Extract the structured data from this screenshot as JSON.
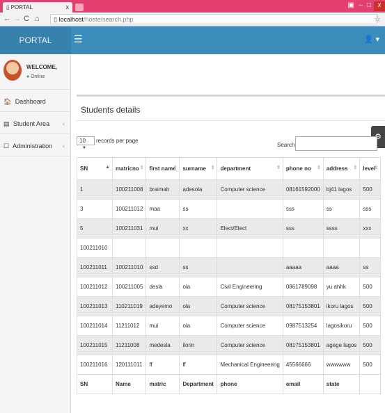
{
  "browser": {
    "tab_title": "PORTAL",
    "tab_close": "x",
    "url_host": "localhost",
    "url_path": "/hoste/search.php",
    "win_min": "‒",
    "win_max": "□",
    "win_close": "x"
  },
  "app": {
    "brand": "PORTAL",
    "hamburger": "☰",
    "user_icon": "👤 ▾"
  },
  "sidebar": {
    "welcome": "WELCOME,",
    "status": "Online",
    "items": [
      {
        "label": "Dashboard",
        "icon": "🏠",
        "icon_name": "dashboard-icon"
      },
      {
        "label": "Student Area",
        "icon": "▤",
        "icon_name": "student-area-icon"
      },
      {
        "label": "Administration",
        "icon": "☐",
        "icon_name": "administration-icon"
      }
    ]
  },
  "panel": {
    "title": "Students details",
    "length_value": "10",
    "length_suffix": "records per page",
    "search_label": "Search:",
    "settings_icon": "⚙"
  },
  "table": {
    "headers": [
      "SN",
      "matricno",
      "first name",
      "surname",
      "department",
      "phone no",
      "address",
      "level"
    ],
    "rows": [
      [
        "1",
        "100211008",
        "braimah",
        "adesola",
        "Computer science",
        "08161592000",
        "bj41 lagos",
        "500"
      ],
      [
        "3",
        "100211012",
        "maa",
        "ss",
        "",
        "sss",
        "ss",
        "sss"
      ],
      [
        "5",
        "100211031",
        "mui",
        "xx",
        "Elect/Elect",
        "sss",
        "ssss",
        "xxx"
      ],
      [
        "100211010",
        "",
        "",
        "",
        "",
        "",
        "",
        ""
      ],
      [
        "100211011",
        "100211010",
        "ssd",
        "ss",
        "",
        "aaaaa",
        "aaaa",
        "ss"
      ],
      [
        "100211012",
        "100211005",
        "desla",
        "ola",
        "Civil Engineering",
        "0861789098",
        "yu ahhk",
        "500"
      ],
      [
        "100211013",
        "110211019",
        "adeyemo",
        "ola",
        "Computer science",
        "08175153801",
        "ikoru lagos",
        "500"
      ],
      [
        "100211014",
        "11211012",
        "mui",
        "ola",
        "Computer science",
        "0987513254",
        "lagosikoru",
        "500"
      ],
      [
        "100211015",
        "11211008",
        "medesla",
        "ilorin",
        "Computer science",
        "08175153801",
        "agege lagos",
        "500"
      ],
      [
        "100211016",
        "120111011",
        "ff",
        "ff",
        "Mechanical Engineering",
        "45566666",
        "wwwwww",
        "500"
      ]
    ],
    "footer": [
      "SN",
      "Name",
      "matric",
      "Department",
      "phone",
      "email",
      "state",
      ""
    ]
  }
}
